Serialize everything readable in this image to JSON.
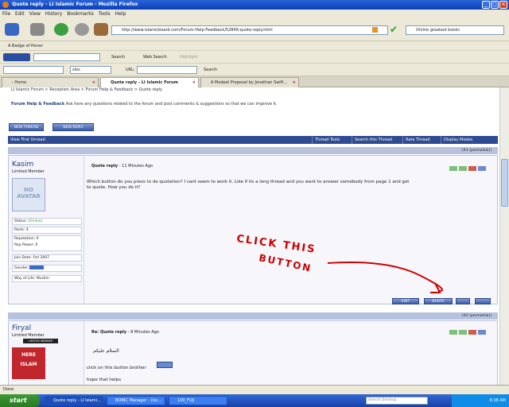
{
  "window": {
    "title": "Quote reply - LI Islamic Forum - Mozilla Firefox"
  },
  "menu": [
    "File",
    "Edit",
    "View",
    "History",
    "Bookmarks",
    "Tools",
    "Help"
  ],
  "nav": {
    "url": "http://www.islamicboard.com/Forum-Help-Feedback/52849-quote-reply.html",
    "search_value": "Online greatest books"
  },
  "bookmarks": {
    "item": "A Badge of Honor"
  },
  "toolbar1": {
    "search_label": "Search",
    "web_search_label": "Web Search",
    "highlight_label": "Highlight"
  },
  "toolbar2": {
    "site_label": "site:",
    "url_label": "URL:",
    "search_button": "Search"
  },
  "tabs": [
    {
      "label": "- Home"
    },
    {
      "label": "Quote reply - LI Islamic Forum"
    },
    {
      "label": "A Modest Proposal by Jonathan Swift..."
    }
  ],
  "breadcrumb": "LI Islamic Forum > Reception Area > Forum Help & Feedback > Quote reply",
  "forum_help": {
    "title": "Forum Help & Feedback",
    "desc": "Ask here any questions related to the forum and post comments & suggestions so that we can improve it."
  },
  "buttons": {
    "new_thread": "NEW THREAD",
    "new_reply": "NEW REPLY"
  },
  "thread_bar": {
    "view_first_unread": "View First Unread",
    "thread_tools": "Thread Tools",
    "search_thread": "Search this Thread",
    "rate_thread": "Rate Thread",
    "display_modes": "Display Modes"
  },
  "post1": {
    "permalink": "(#1 (permalink))",
    "username": "Kasim",
    "user_title": "Limited Member",
    "avatar_text": "NO AVATAR",
    "status_label": "Status:",
    "status_value": "(Online)",
    "posts": "Posts: 4",
    "reputation": "Reputation: 0",
    "rep_power": "Rep Power: 0",
    "join_date": "Join Date: Oct 2007",
    "gender_label": "Gender:",
    "way_of_life": "Way of Life: Muslim",
    "title": "Quote reply",
    "time": "- 11 Minutes Ago",
    "body": "Which button do you press to do quotation? I cant seem to work it. Like if its a long thread and you want to answer somebody from page 1 and got to quote. How you do it?",
    "annotation_line1": "CLICK THIS",
    "annotation_line2": "BUTTON",
    "edit_btn": "EDIT",
    "quote_btn": "QUOTE"
  },
  "post2": {
    "permalink": "(#2 (permalink))",
    "username": "Firyal",
    "user_title": "Limited Member",
    "badge": "LIMITED MEMBER",
    "img_here": "HERE",
    "img_islam": "ISLAM",
    "title": "Re: Quote reply",
    "time": "- 8 Minutes Ago",
    "salam": "السلام عليكم",
    "body1": "click on this button brother",
    "body2": "hope that helps"
  },
  "status_bar": "Done",
  "taskbar": {
    "start": "start",
    "tasks": [
      "Quote reply - LI Islami...",
      "BOINC Manager - (loc...",
      "100_FUJI"
    ],
    "desktop_search": "Search Desktop",
    "clock": "8:38 AM"
  },
  "colors": {
    "accent": "#2f4b91",
    "annotation": "#cc0000"
  }
}
